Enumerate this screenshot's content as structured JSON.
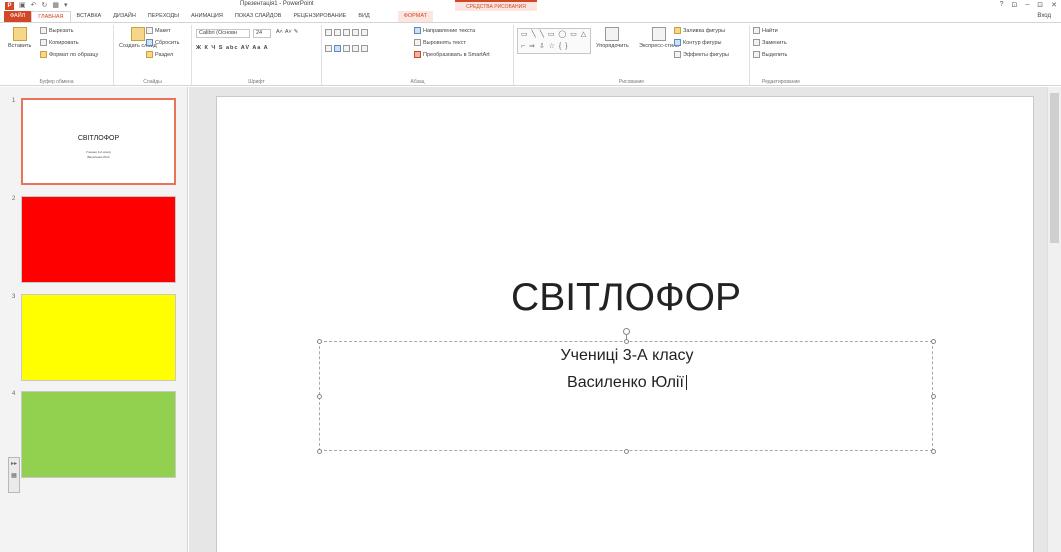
{
  "app": {
    "title": "Презентація1 - PowerPoint",
    "logo": "P",
    "qat_icons": [
      "save-icon",
      "undo-icon",
      "redo-icon",
      "present-icon",
      "customize-icon"
    ],
    "context_header": "СРЕДСТВА РИСОВАНИЯ",
    "window_controls": [
      "?",
      "⊡",
      "–",
      "⊡",
      "✕"
    ],
    "login": "Вход"
  },
  "tabs": [
    {
      "label": "ФАЙЛ",
      "kind": "file"
    },
    {
      "label": "ГЛАВНАЯ",
      "kind": "active"
    },
    {
      "label": "ВСТАВКА",
      "kind": ""
    },
    {
      "label": "ДИЗАЙН",
      "kind": ""
    },
    {
      "label": "ПЕРЕХОДЫ",
      "kind": ""
    },
    {
      "label": "АНИМАЦИЯ",
      "kind": ""
    },
    {
      "label": "ПОКАЗ СЛАЙДОВ",
      "kind": ""
    },
    {
      "label": "РЕЦЕНЗИРОВАНИЕ",
      "kind": ""
    },
    {
      "label": "ВИД",
      "kind": ""
    },
    {
      "label": "ФОРМАТ",
      "kind": "ctx"
    }
  ],
  "ribbon": {
    "clipboard": {
      "label": "Буфер обмена",
      "paste": "Вставить",
      "cut": "Вырезать",
      "copy": "Копировать",
      "format_painter": "Формат по образцу"
    },
    "slides": {
      "label": "Слайды",
      "new_slide": "Создать слайд",
      "layout": "Макет",
      "reset": "Сбросить",
      "section": "Раздел"
    },
    "font": {
      "label": "Шрифт",
      "family": "Calibri (Основн",
      "size": "24",
      "format_row": "Ж К Ч S abc AV Aa A"
    },
    "paragraph": {
      "label": "Абзац",
      "text_direction": "Направление текста",
      "align_text": "Выровнять текст",
      "smartart": "Преобразовать в SmartArt"
    },
    "drawing": {
      "label": "Рисование",
      "shapes_preview": "▭ ╲ ╲ ▭ ◯ ▭ △ ⌐ ⇒ ⇩ ☆ { }",
      "arrange": "Упорядочить",
      "quick_styles": "Экспресс-стили",
      "fill": "Заливка фигуры",
      "outline": "Контур фигуры",
      "effects": "Эффекты фигуры"
    },
    "editing": {
      "label": "Редактирование",
      "find": "Найти",
      "replace": "Заменить",
      "select": "Выделить"
    }
  },
  "thumbnails": [
    {
      "num": "1",
      "title": "СВІТЛОФОР",
      "sub1": "Учениці 3-А класу",
      "sub2": "Василенко Юлії",
      "color": "#ffffff"
    },
    {
      "num": "2",
      "color": "#ff0000"
    },
    {
      "num": "3",
      "color": "#ffff00"
    },
    {
      "num": "4",
      "color": "#92d050"
    }
  ],
  "slide": {
    "title": "СВІТЛОФОР",
    "subtitle_line1": "Учениці 3-А класу",
    "subtitle_line2": "Василенко Юлії"
  },
  "colors": {
    "accent": "#d24726",
    "slide2": "#ff0000",
    "slide3": "#ffff00",
    "slide4": "#92d050"
  }
}
